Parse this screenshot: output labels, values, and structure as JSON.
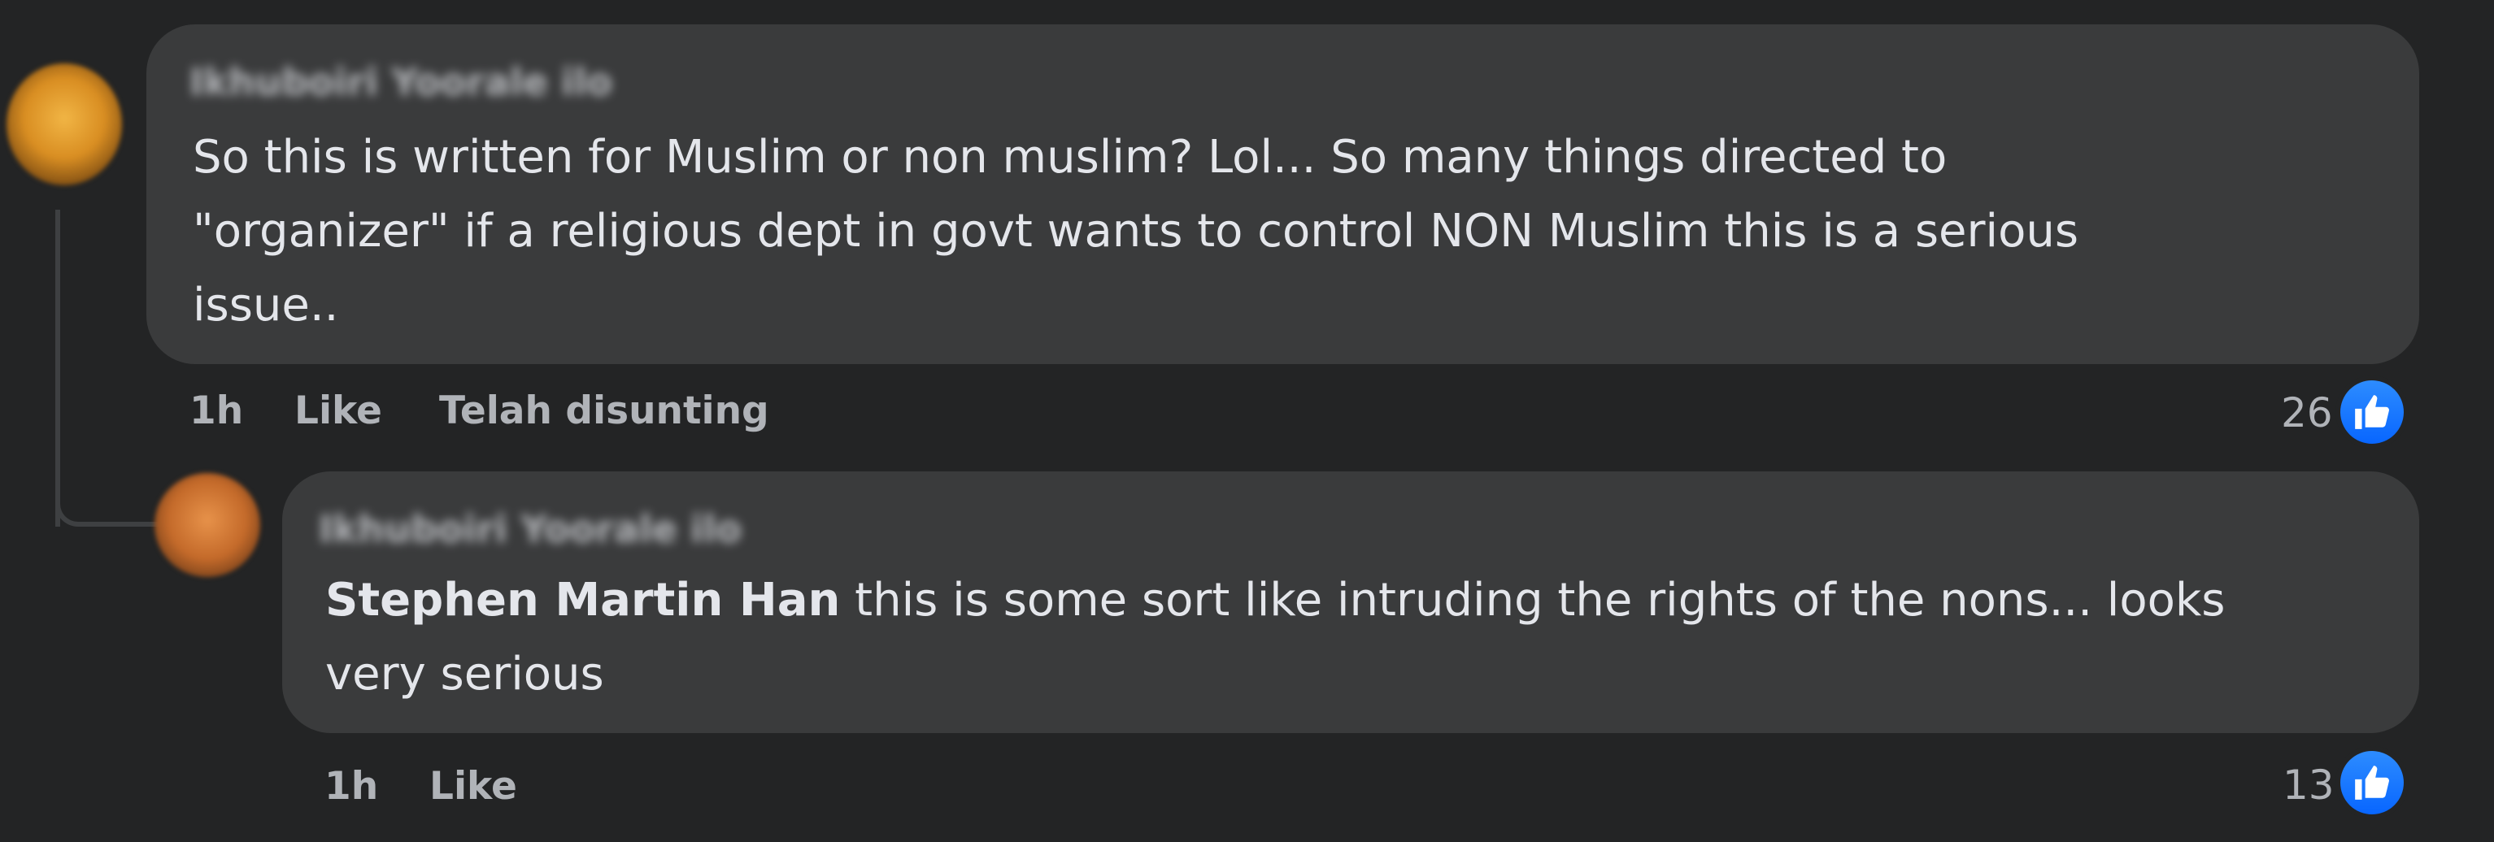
{
  "comments": [
    {
      "author": "Ikhuboiri Yoorale ilo",
      "text": "So this is written for Muslim or non muslim? Lol... So many things directed to\n\"organizer\" if a religious dept in govt wants to control NON Muslim this is a serious\nissue..",
      "time": "1h",
      "like_label": "Like",
      "edited_label": "Telah disunting",
      "reaction_count": "26",
      "reaction_icon": "thumbs-up-icon"
    },
    {
      "author": "Ikhuboiri Yoorale ilo",
      "mention": "Stephen Martin Han",
      "text": " this is some sort like intruding the rights of the nons... looks\nvery serious",
      "time": "1h",
      "like_label": "Like",
      "reaction_count": "13",
      "reaction_icon": "thumbs-up-icon"
    }
  ],
  "colors": {
    "background": "#232425",
    "bubble": "#3a3b3c",
    "text": "#e4e6eb",
    "meta": "#b0b3b8",
    "like_blue": "#0866ff"
  }
}
